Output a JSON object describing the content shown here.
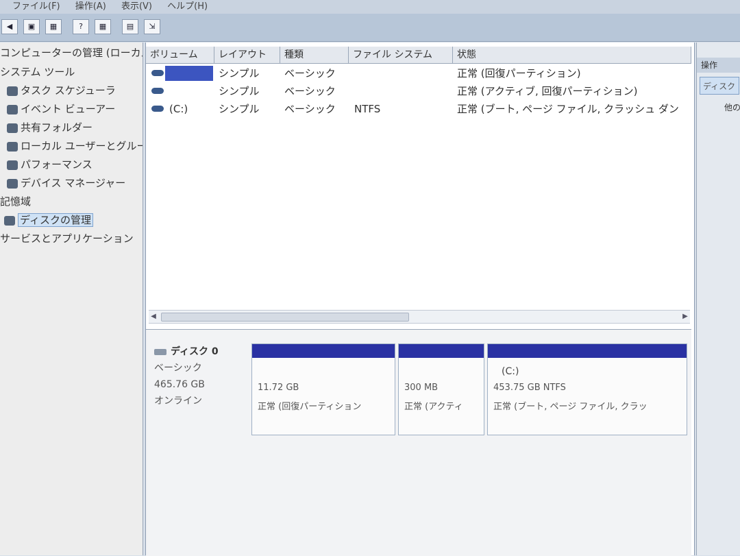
{
  "menubar": {
    "items": [
      "ファイル(F)",
      "操作(A)",
      "表示(V)",
      "ヘルプ(H)"
    ]
  },
  "toolbar": {
    "icons": [
      "back-arrow-icon",
      "folder-icon",
      "view-icon",
      "help-icon",
      "view-icon",
      "properties-icon",
      "export-icon"
    ]
  },
  "tree": {
    "root": "コンピューターの管理 (ローカル)",
    "items": [
      {
        "label": "システム ツール",
        "icon": "tools-icon"
      },
      {
        "label": "タスク スケジューラ",
        "icon": "clock-icon"
      },
      {
        "label": "イベント ビューアー",
        "icon": "event-viewer-icon"
      },
      {
        "label": "共有フォルダー",
        "icon": "shared-folder-icon"
      },
      {
        "label": "ローカル ユーザーとグループ",
        "icon": "users-icon"
      },
      {
        "label": "パフォーマンス",
        "icon": "performance-icon"
      },
      {
        "label": "デバイス マネージャー",
        "icon": "device-manager-icon"
      },
      {
        "label": "記憶域",
        "icon": "storage-icon"
      },
      {
        "label": "ディスクの管理",
        "icon": "disk-icon"
      },
      {
        "label": "サービスとアプリケーション",
        "icon": "services-icon"
      }
    ]
  },
  "volume_list": {
    "columns": [
      "ボリューム",
      "レイアウト",
      "種類",
      "ファイル システム",
      "状態"
    ],
    "rows": [
      {
        "volume": "",
        "layout": "シンプル",
        "type": "ベーシック",
        "fs": "",
        "status": "正常 (回復パーティション)"
      },
      {
        "volume": "",
        "layout": "シンプル",
        "type": "ベーシック",
        "fs": "",
        "status": "正常 (アクティブ, 回復パーティション)"
      },
      {
        "volume": "(C:)",
        "layout": "シンプル",
        "type": "ベーシック",
        "fs": "NTFS",
        "status": "正常 (ブート, ページ ファイル, クラッシュ ダン"
      }
    ]
  },
  "disk": {
    "name": "ディスク 0",
    "type": "ベーシック",
    "size": "465.76 GB",
    "status": "オンライン",
    "partitions": [
      {
        "label": "",
        "size": "11.72 GB",
        "status": "正常 (回復パーティション"
      },
      {
        "label": "",
        "size": "300 MB",
        "status": "正常 (アクティ"
      },
      {
        "label": "(C:)",
        "size": "453.75 GB NTFS",
        "status": "正常 (ブート, ページ ファイル, クラッ"
      }
    ]
  },
  "actions": {
    "header": "操作",
    "selected": "ディスク",
    "item": "他の"
  },
  "colors": {
    "partition_bar": "#2a31a3",
    "selection": "#3c55c0"
  }
}
